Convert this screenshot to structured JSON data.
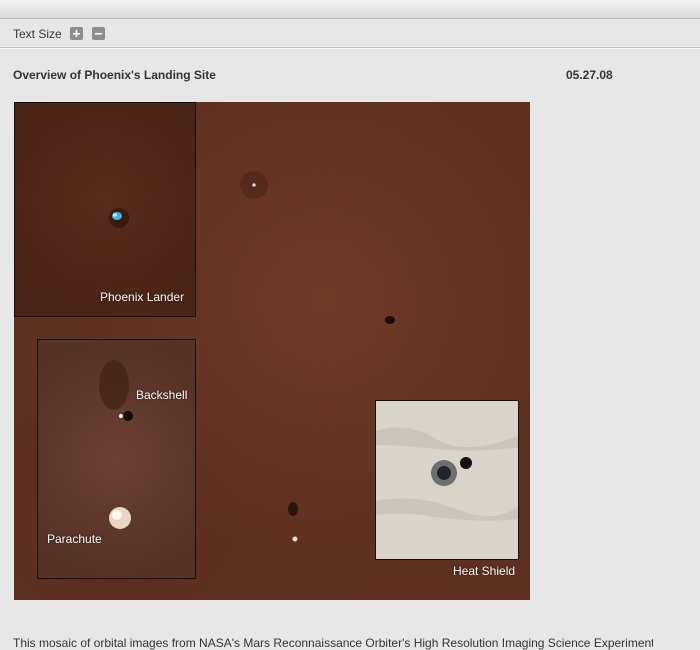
{
  "toolbar": {
    "text_size_label": "Text Size",
    "increase_icon": "plus-icon",
    "decrease_icon": "minus-icon"
  },
  "article": {
    "title": "Overview of Phoenix's Landing Site",
    "date": "05.27.08",
    "body": "This mosaic of orbital images from NASA's Mars Reconnaissance Orbiter's High Resolution Imaging Science Experiment shows"
  },
  "image": {
    "labels": {
      "lander": "Phoenix Lander",
      "backshell": "Backshell",
      "parachute": "Parachute",
      "heat_shield": "Heat Shield"
    }
  },
  "colors": {
    "page_background": "#e7e7e7",
    "mars_surface": "#5f301f",
    "text": "#333333"
  }
}
